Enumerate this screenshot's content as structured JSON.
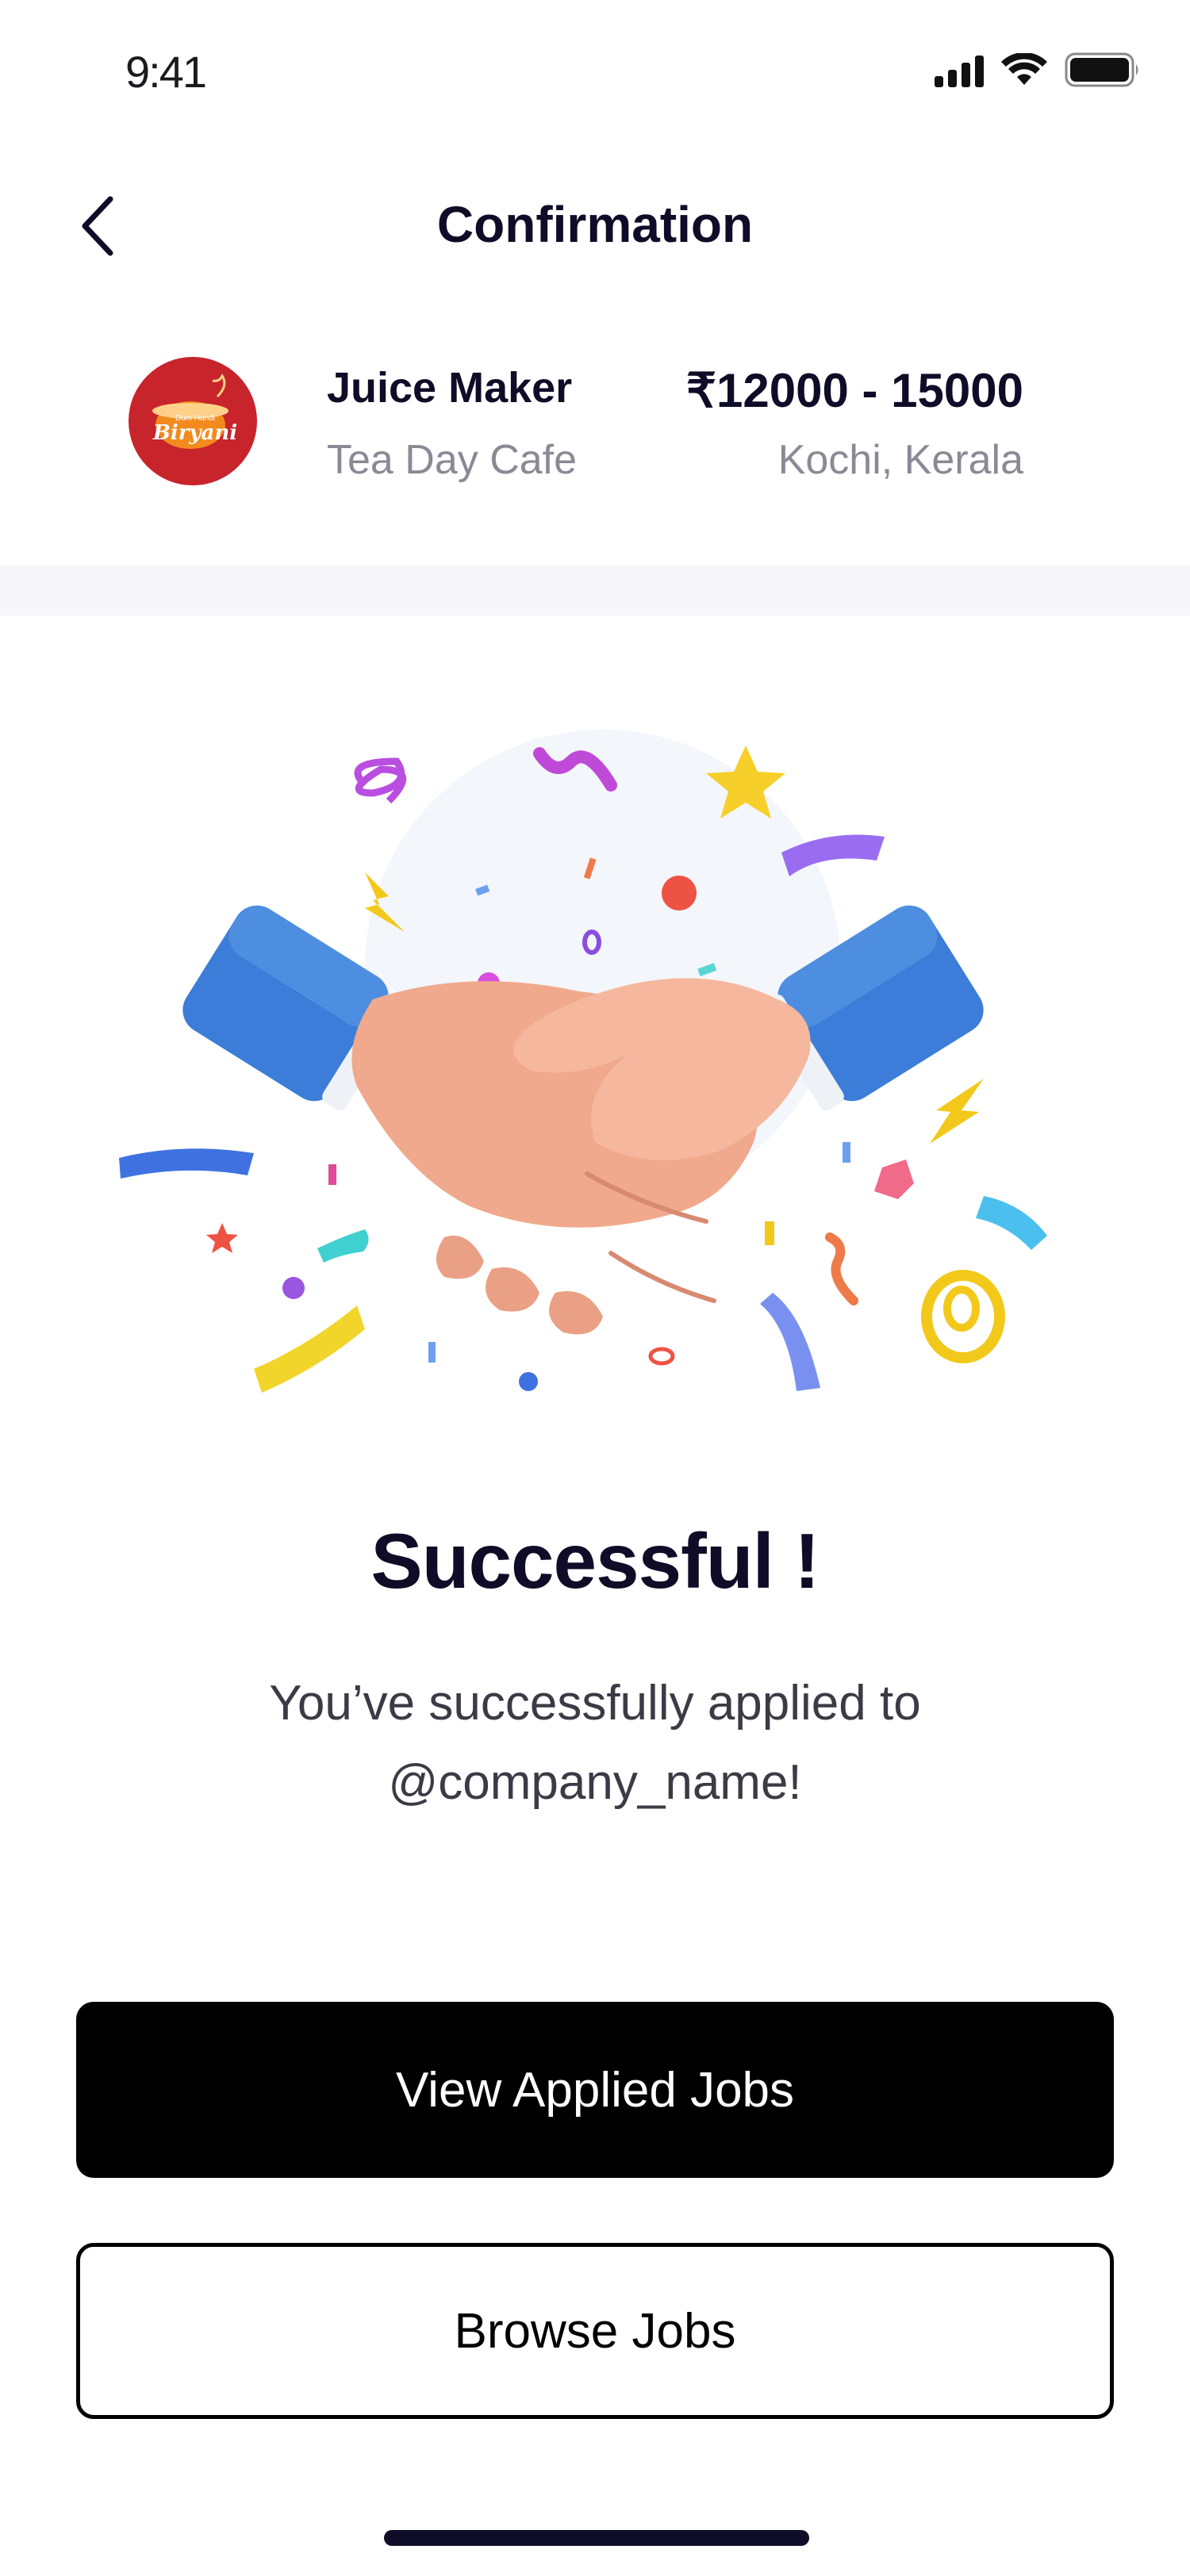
{
  "status_bar": {
    "time": "9:41",
    "icons": [
      "signal-icon",
      "wifi-icon",
      "battery-icon"
    ]
  },
  "header": {
    "title": "Confirmation",
    "back_icon": "chevron-left-icon"
  },
  "job": {
    "title": "Juice Maker",
    "company": "Tea Day Cafe",
    "salary": "₹12000 - 15000",
    "location": "Kochi, Kerala",
    "logo": {
      "line1": "Dum Handi",
      "line2": "Biryani",
      "color": "#c8242b"
    }
  },
  "result": {
    "title": "Successful !",
    "message": "You’ve successfully applied to @company_name!"
  },
  "buttons": {
    "primary": "View Applied Jobs",
    "secondary": "Browse Jobs"
  },
  "colors": {
    "text_dark": "#0e0c27",
    "text_muted": "#8a8a95",
    "primary_button": "#000000",
    "sleeve_blue": "#3b7dd8",
    "skin": "#f0a98c"
  }
}
